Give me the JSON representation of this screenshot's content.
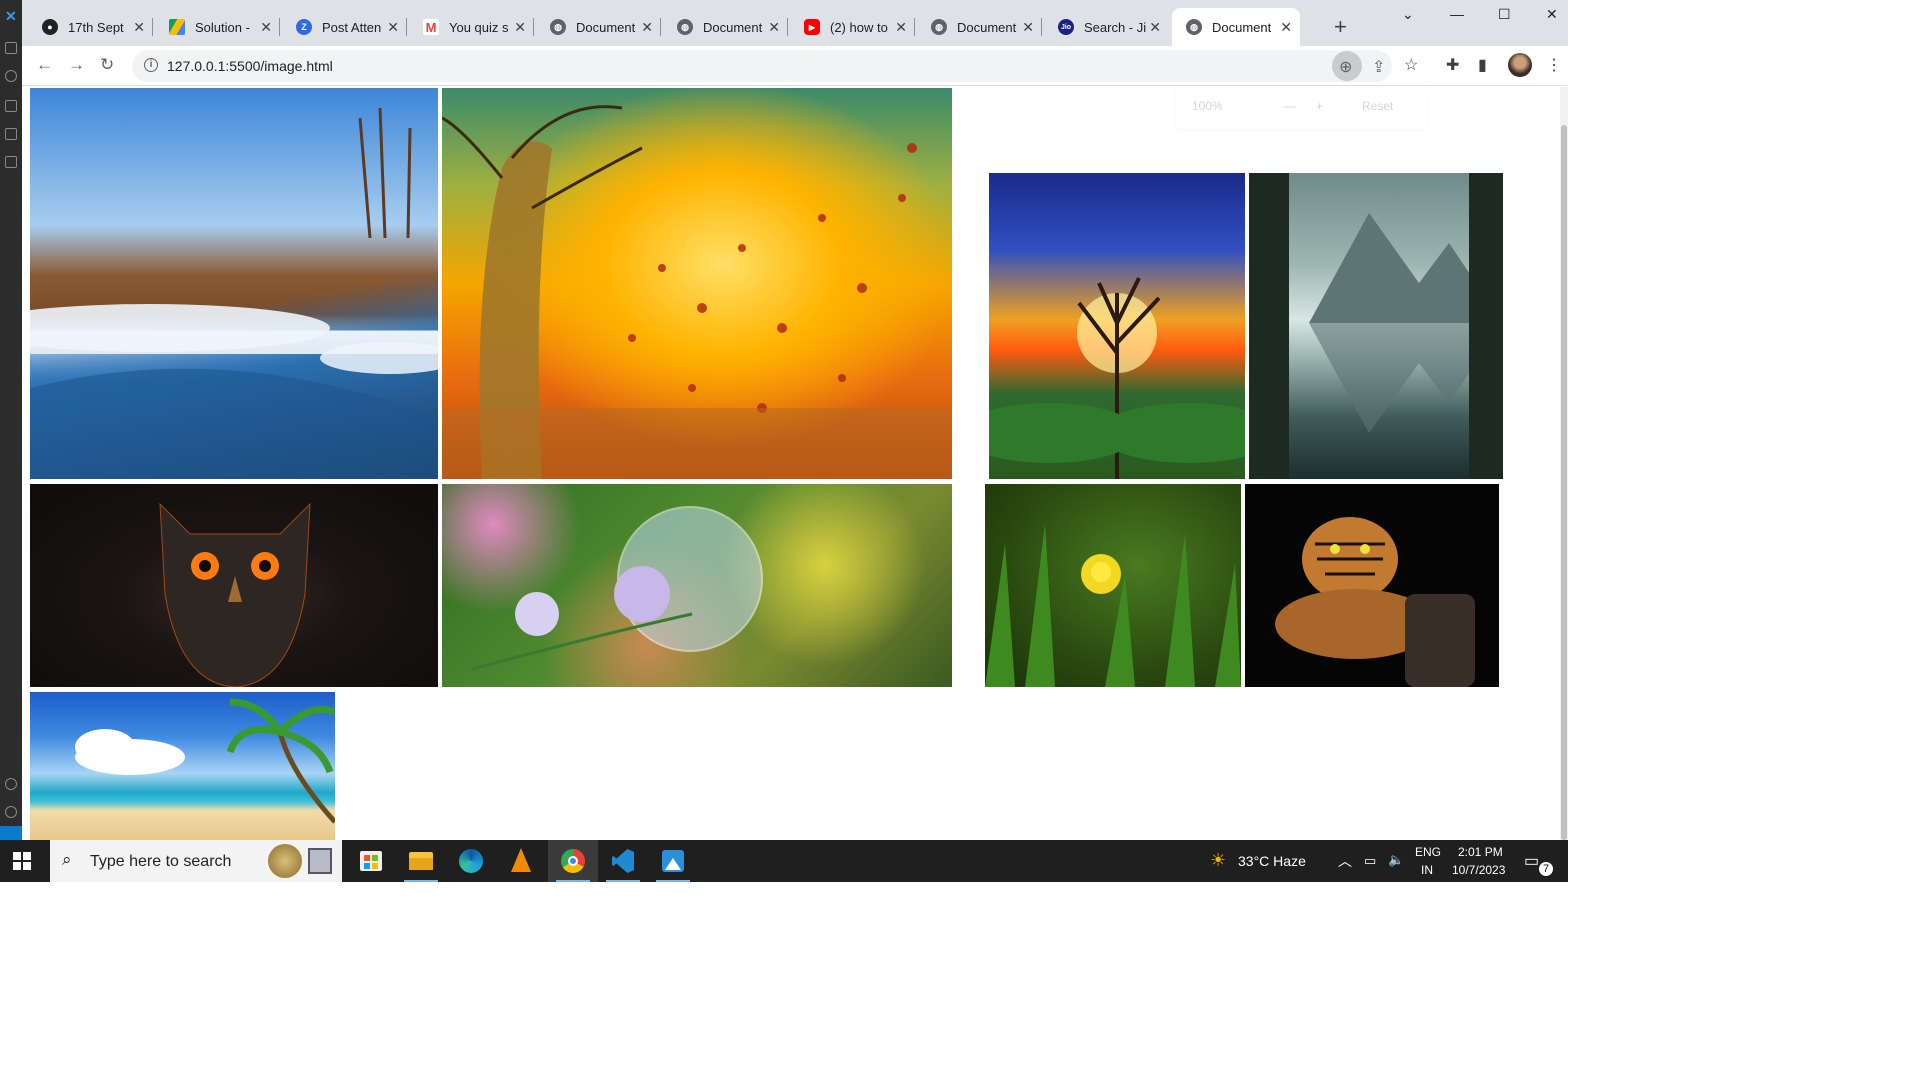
{
  "browser": {
    "tabs": [
      {
        "title": "17th Sept",
        "favicon_color": "#222222",
        "favicon_glyph": "github-icon"
      },
      {
        "title": "Solution - ",
        "favicon_color": "#fbbc04",
        "favicon_glyph": "google-drive-icon"
      },
      {
        "title": "Post Atten",
        "favicon_color": "#2d6be4",
        "favicon_glyph": "zoom-icon"
      },
      {
        "title": "You quiz s",
        "favicon_color": "#ea4335",
        "favicon_glyph": "gmail-icon"
      },
      {
        "title": "Document",
        "favicon_color": "#5f6368",
        "favicon_glyph": "globe-icon"
      },
      {
        "title": "Document",
        "favicon_color": "#5f6368",
        "favicon_glyph": "globe-icon"
      },
      {
        "title": "(2) how to",
        "favicon_color": "#ff0000",
        "favicon_glyph": "youtube-icon"
      },
      {
        "title": "Document",
        "favicon_color": "#5f6368",
        "favicon_glyph": "globe-icon"
      },
      {
        "title": "Search - Ji",
        "favicon_color": "#1a237e",
        "favicon_glyph": "jio-icon"
      },
      {
        "title": "Document",
        "favicon_color": "#5f6368",
        "favicon_glyph": "globe-icon",
        "active": true
      }
    ],
    "url": "127.0.0.1:5500/image.html",
    "zoom_popup": {
      "level": "100%",
      "reset_label": "Reset"
    }
  },
  "gallery": {
    "images": [
      {
        "name": "winter-river-image",
        "subject": "snowy river landscape"
      },
      {
        "name": "autumn-woman-image",
        "subject": "autumn tree woman with leaves"
      },
      {
        "name": "fantasy-tree-sunset-image",
        "subject": "fantasy tree sunset"
      },
      {
        "name": "mountain-lake-image",
        "subject": "mountain lake reflection"
      },
      {
        "name": "owl-image",
        "subject": "dark owl"
      },
      {
        "name": "water-bubble-flower-image",
        "subject": "bubble on flower"
      },
      {
        "name": "yellow-flower-grass-image",
        "subject": "yellow flower in grass"
      },
      {
        "name": "tiger-image",
        "subject": "tiger on black"
      },
      {
        "name": "tropical-beach-image",
        "subject": "tropical beach"
      }
    ]
  },
  "taskbar": {
    "search_placeholder": "Type here to search",
    "weather": "33°C  Haze",
    "language": "ENG",
    "region": "IN",
    "time": "2:01 PM",
    "date": "10/7/2023",
    "notification_count": "7"
  }
}
